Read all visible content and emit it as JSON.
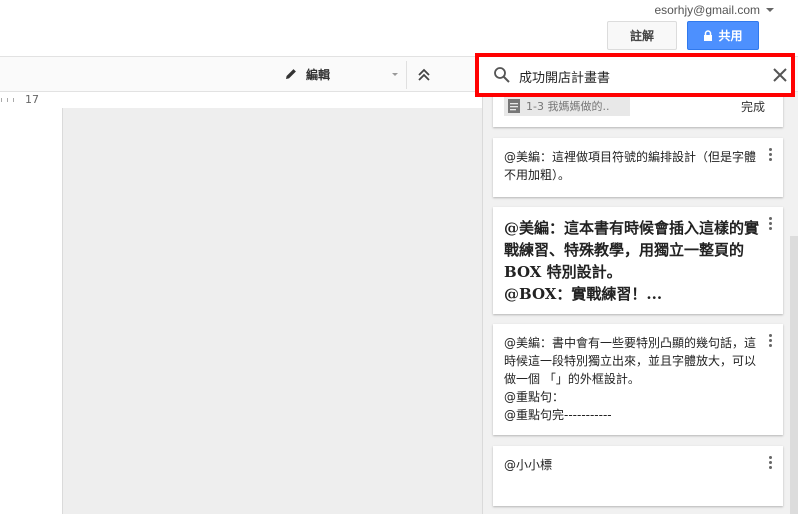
{
  "account": {
    "email": "esorhjy@gmail.com"
  },
  "header": {
    "comments_label": "註解",
    "share_label": "共用"
  },
  "toolbar": {
    "mode_label": "編輯"
  },
  "ruler": {
    "number": "17"
  },
  "search": {
    "value": "成功開店計畫書"
  },
  "comments": [
    {
      "file_chip": "1-3 我媽媽做的..",
      "status": "完成"
    },
    {
      "text": "@美編：這裡做項目符號的編排設計（但是字體不用加粗）。"
    },
    {
      "text": "@美編：這本書有時候會插入這樣的實戰練習、特殊教學，用獨立一整頁的 BOX 特別設計。\n@BOX：實戰練習！..."
    },
    {
      "text": "@美編：書中會有一些要特別凸顯的幾句話，這時候這一段特別獨立出來，並且字體放大，可以做一個 「」的外框設計。\n@重點句：\n@重點句完-----------"
    },
    {
      "text": "@小小標"
    }
  ]
}
